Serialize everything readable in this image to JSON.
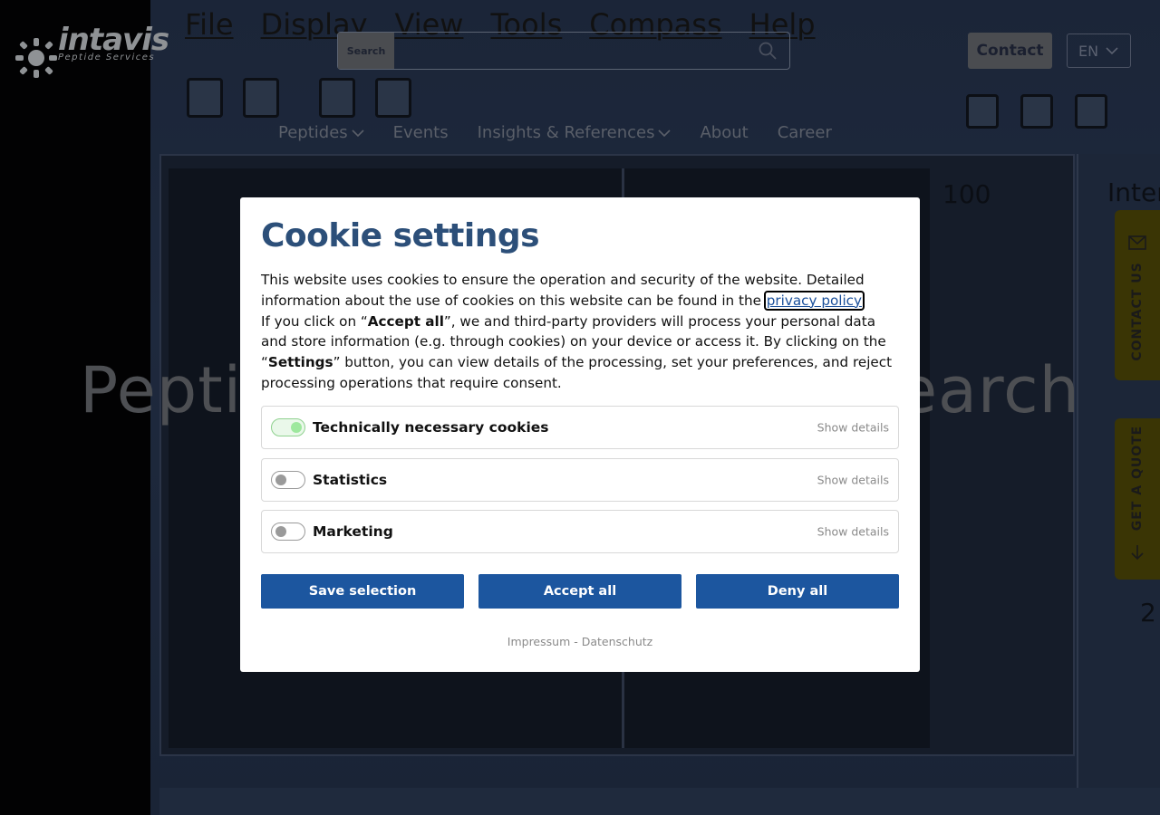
{
  "background": {
    "app_menu": [
      "File",
      "Display",
      "View",
      "Tools",
      "Compass",
      "Help"
    ],
    "numbers": [
      "100",
      "Inten",
      "2"
    ]
  },
  "header": {
    "logo_text": "intavis",
    "logo_sub": "Peptide Services",
    "search_label": "Search",
    "contact_label": "Contact",
    "language": "EN",
    "nav": [
      {
        "label": "Peptides",
        "has_dropdown": true
      },
      {
        "label": "Events",
        "has_dropdown": false
      },
      {
        "label": "Insights & References",
        "has_dropdown": true
      },
      {
        "label": "About",
        "has_dropdown": false
      },
      {
        "label": "Career",
        "has_dropdown": false
      }
    ]
  },
  "hero": {
    "title_left": "Peptic",
    "title_right": "earch"
  },
  "side_tabs": {
    "contact": "CONTACT US",
    "quote": "GET A QUOTE"
  },
  "cookie_modal": {
    "title": "Cookie settings",
    "intro_1": "This website uses cookies to ensure the operation and security of the website. Detailed information about the use of cookies on this website can be found in the",
    "privacy_link": "privacy policy",
    "intro_2a": "If you click on “",
    "accept_bold": "Accept all",
    "intro_2b": "”, we and third-party providers will process your personal data and store information (e.g. through cookies) on your device or access it. By clicking on the “",
    "settings_bold": "Settings",
    "intro_2c": "” button, you can view details of the processing, set your preferences, and reject processing operations that require consent.",
    "categories": [
      {
        "label": "Technically necessary cookies",
        "enabled": true,
        "details": "Show details"
      },
      {
        "label": "Statistics",
        "enabled": false,
        "details": "Show details"
      },
      {
        "label": "Marketing",
        "enabled": false,
        "details": "Show details"
      }
    ],
    "buttons": {
      "save": "Save selection",
      "accept": "Accept all",
      "deny": "Deny all"
    },
    "footer": {
      "impressum": "Impressum",
      "separator": " - ",
      "datenschutz": "Datenschutz"
    }
  },
  "colors": {
    "title": "#2c4f79",
    "button": "#1c569f",
    "toggle_on": "#9ee89e",
    "side_tab": "#3a3505"
  }
}
